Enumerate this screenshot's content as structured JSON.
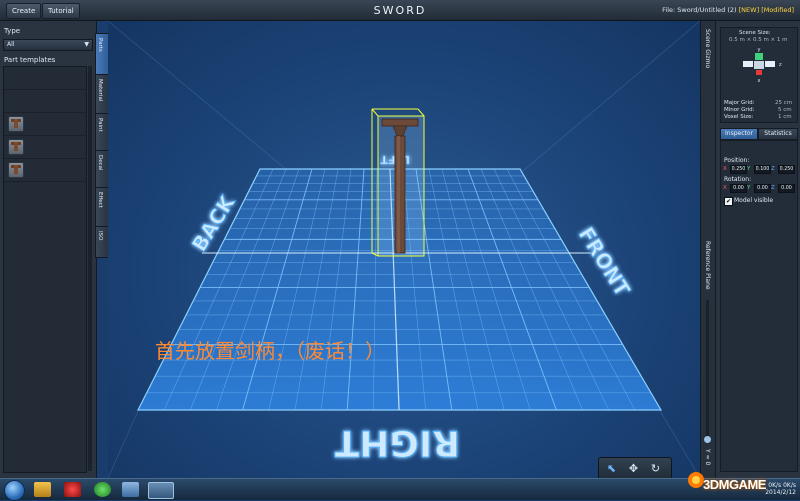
{
  "topbar": {
    "create_label": "Create",
    "tutorial_label": "Tutorial",
    "title": "SWORD",
    "file_prefix": "File: Sword/Untitled (2)",
    "new_tag": "[NEW]",
    "modified_tag": "[Modified]"
  },
  "left_panel": {
    "type_label": "Type",
    "type_value": "All",
    "templates_label": "Part templates",
    "vertical_tabs": [
      "Parts",
      "Material",
      "Paint",
      "Decal",
      "Effect",
      "ISO"
    ]
  },
  "viewport": {
    "labels": {
      "back": "BACK",
      "front": "FRONT",
      "right": "RIGHT",
      "left": "LEFT"
    },
    "caption": "首先放置剑柄，（废话！）",
    "colors": {
      "grid": "#3f9cff",
      "label_glow": "#5ab8ff",
      "selection": "#f2ff3d",
      "handle": "#6b4a3a",
      "caption": "#ff8a33"
    }
  },
  "right_panel": {
    "scene_gizmo_tab": "Scene Gizmo",
    "reference_plane_tab": "Reference Plane",
    "y_value_label": "Y = 0",
    "scene_size_label": "Scene Size:",
    "scene_size_value": "0.5 m × 0.5 m × 1 m",
    "gizmo_axes": {
      "y": "y",
      "x": "x",
      "z": "z"
    },
    "major_grid_label": "Major Grid:",
    "major_grid_value": "25 cm",
    "minor_grid_label": "Minor Grid:",
    "minor_grid_value": "5 cm",
    "voxel_size_label": "Voxel Size:",
    "voxel_size_value": "1 cm",
    "tabs": {
      "inspector": "Inspector",
      "statistics": "Statistics"
    },
    "position_label": "Position:",
    "position": {
      "x": "0.250",
      "y": "0.100",
      "z": "0.250"
    },
    "rotation_label": "Rotation:",
    "rotation": {
      "x": "0.00",
      "y": "0.00",
      "z": "0.00"
    },
    "axis_labels": {
      "x": "X",
      "y": "Y",
      "z": "Z"
    },
    "model_visible_label": "Model visible",
    "model_visible": true
  },
  "tray": {
    "line1": "0K/s 0K/s",
    "date": "2014/2/12"
  },
  "watermark": "3DMGAME"
}
